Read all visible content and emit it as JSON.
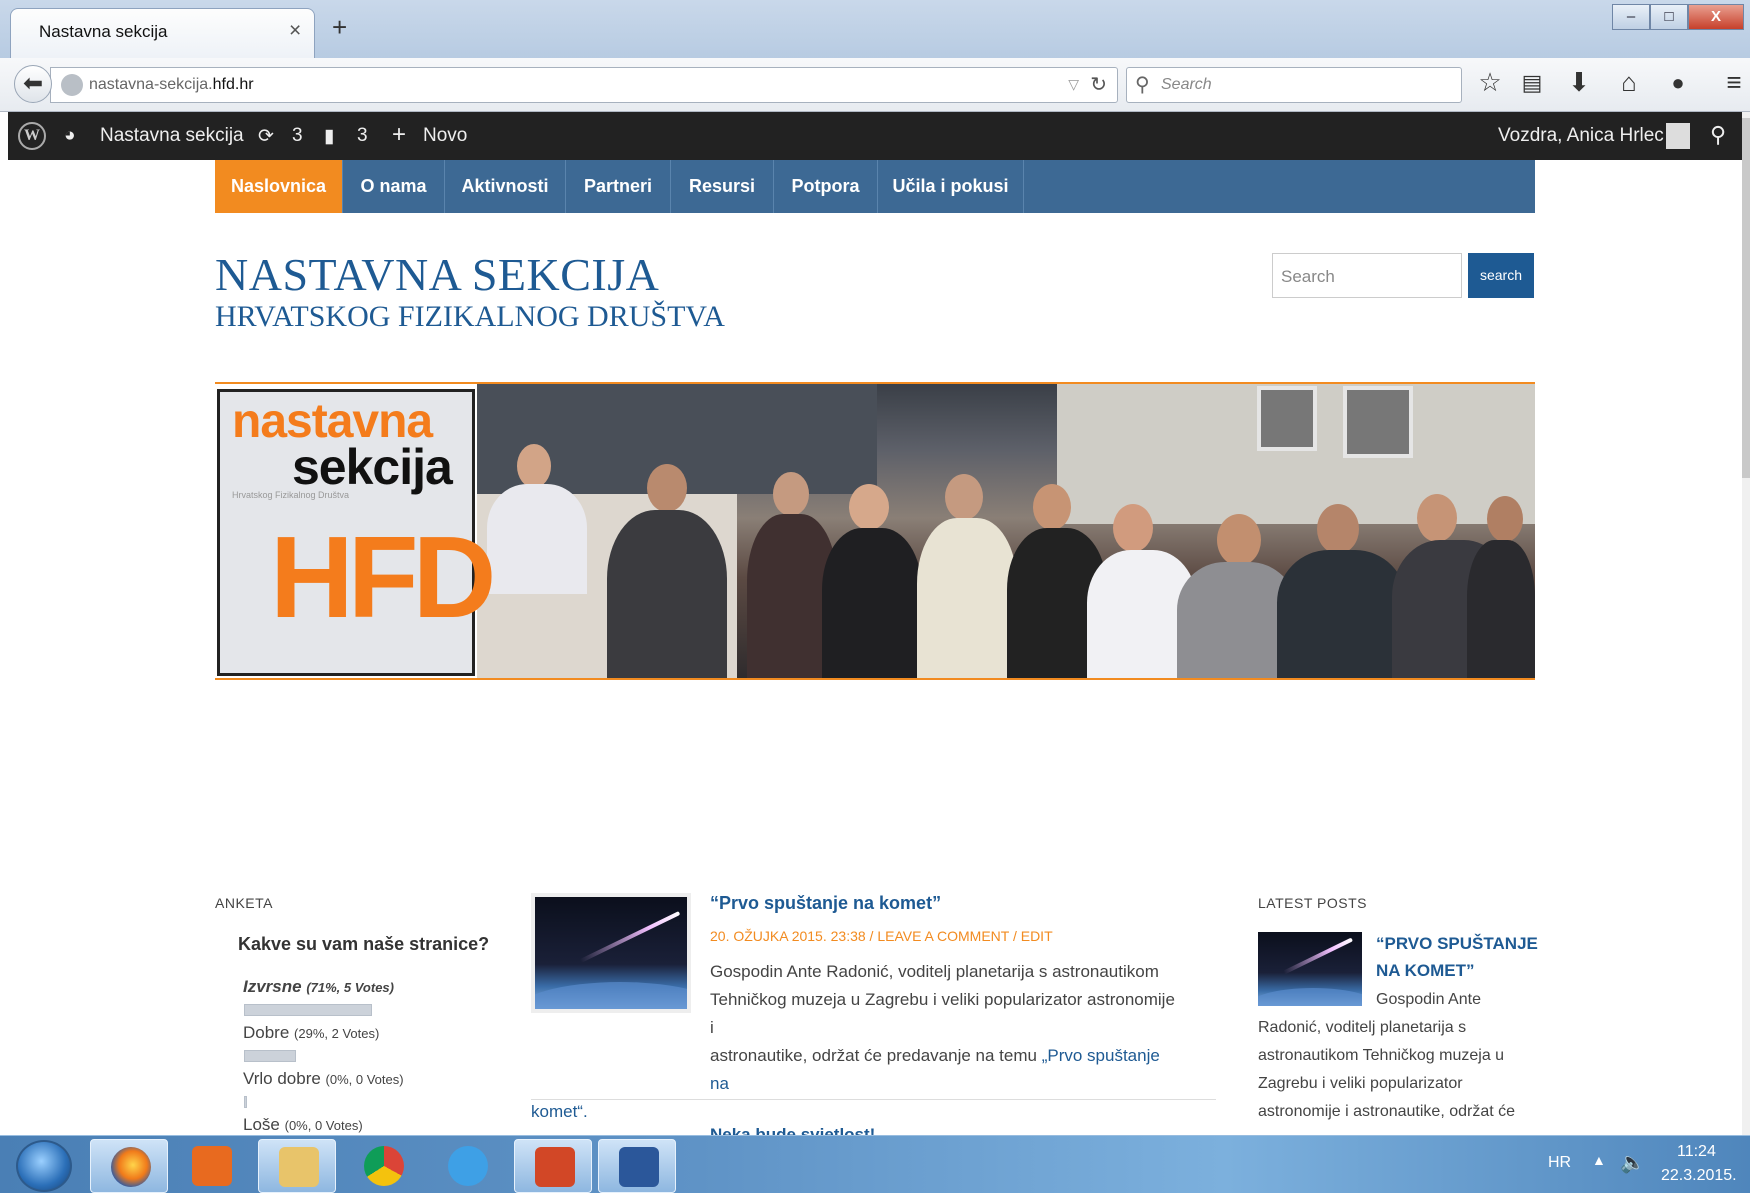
{
  "browser": {
    "tab_title": "Nastavna sekcija",
    "tab_close": "×",
    "new_tab": "+",
    "url_prefix": "nastavna-sekcija.",
    "url_host": "hfd.hr",
    "search_placeholder": "Search",
    "window_controls": [
      "–",
      "□",
      "X"
    ]
  },
  "adminbar": {
    "site_name": "Nastavna sekcija",
    "updates_count": "3",
    "comments_count": "3",
    "new_label": "Novo",
    "user_greeting": "Vozdra, Anica Hrlec"
  },
  "nav": {
    "items": [
      {
        "label": "Naslovnica",
        "active": true
      },
      {
        "label": "O nama"
      },
      {
        "label": "Aktivnosti"
      },
      {
        "label": "Partneri"
      },
      {
        "label": "Resursi"
      },
      {
        "label": "Potpora"
      },
      {
        "label": "Učila i pokusi"
      }
    ]
  },
  "header": {
    "title": "NASTAVNA SEKCIJA",
    "subtitle": "HRVATSKOG FIZIKALNOG DRUŠTVA",
    "search_placeholder": "Search",
    "search_button": "search"
  },
  "banner": {
    "logo_line1": "nastavna",
    "logo_line2": "sekcija",
    "logo_line3": "Hrvatskog Fizikalnog Društva",
    "logo_mark": "HFD"
  },
  "poll": {
    "widget_title": "ANKETA",
    "question": "Kakve su vam naše stranice?",
    "answers": [
      {
        "label": "Izvrsne",
        "stats": "(71%, 5 Votes)",
        "percent": 71
      },
      {
        "label": "Dobre",
        "stats": "(29%, 2 Votes)",
        "percent": 29
      },
      {
        "label": "Vrlo dobre",
        "stats": "(0%, 0 Votes)",
        "percent": 0
      },
      {
        "label": "Loše",
        "stats": "(0%, 0 Votes)",
        "percent": 0
      }
    ]
  },
  "post": {
    "title": "“Prvo spuštanje na komet”",
    "meta": "20. OŽUJKA 2015. 23:38 / LEAVE A COMMENT / EDIT",
    "body_line1": "Gospodin Ante Radonić, voditelj planetarija s astronautikom",
    "body_line2": "Tehničkog muzeja u Zagrebu i veliki popularizator astronomije i",
    "body_line3_text": "astronautike, održat će predavanje na temu ",
    "body_link_start": "„Prvo spuštanje na",
    "body_link_end": "komet“.",
    "next_title": "Neka bude svjetlost!"
  },
  "latest_posts": {
    "widget_title": "LATEST POSTS",
    "title": "“PRVO SPUŠTANJE NA KOMET”",
    "excerpt_first": "Gospodin Ante",
    "excerpt_rest": "Radonić, voditelj planetarija s astronautikom Tehničkog muzeja u Zagrebu i veliki popularizator astronomije i astronautike, održat će"
  },
  "taskbar": {
    "lang": "HR",
    "time": "11:24",
    "date": "22.3.2015."
  },
  "colors": {
    "nav_bg": "#3d6994",
    "accent_orange": "#f28b20",
    "title_blue": "#1e5a93",
    "adminbar_bg": "#222222"
  }
}
